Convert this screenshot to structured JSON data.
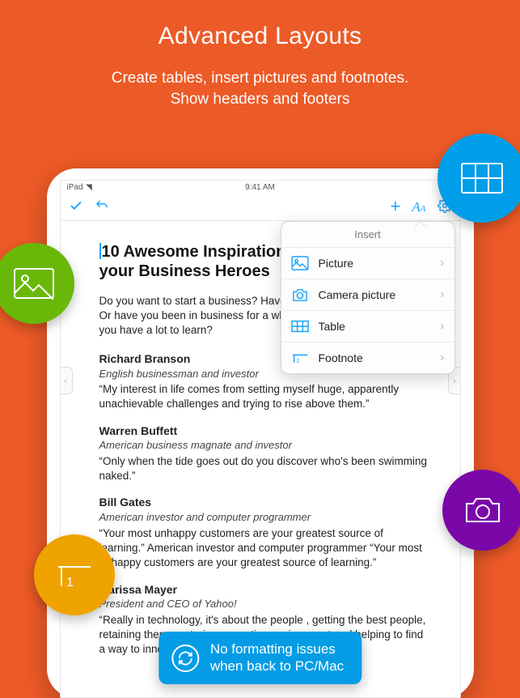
{
  "promo": {
    "title": "Advanced Layouts",
    "subtitle_line1": "Create tables, insert pictures and footnotes.",
    "subtitle_line2": "Show headers and footers"
  },
  "status_bar": {
    "device": "iPad",
    "wifi_icon": "wifi-icon",
    "time": "9:41 AM"
  },
  "toolbar": {
    "confirm_icon": "checkmark-icon",
    "undo_icon": "undo-icon",
    "add_icon": "plus-icon",
    "format_icon": "text-format-icon",
    "settings_icon": "gear-icon"
  },
  "popover": {
    "title": "Insert",
    "items": [
      {
        "icon": "picture-icon",
        "label": "Picture"
      },
      {
        "icon": "camera-icon",
        "label": "Camera picture"
      },
      {
        "icon": "table-icon",
        "label": "Table"
      },
      {
        "icon": "footnote-icon",
        "label": "Footnote"
      }
    ]
  },
  "document": {
    "heading": "10 Awesome Inspirational Quotes from your Business Heroes",
    "lead": "Do you want to start a business? Have you just launched a startup? Or have you been in business for a while perhaps, but you still feel you have a lot to learn?",
    "people": [
      {
        "name": "Richard Branson",
        "role": "English businessman and investor",
        "quote": "“My interest in life comes from setting myself huge, apparently unachievable challenges and trying to rise above them.”"
      },
      {
        "name": "Warren Buffett",
        "role": "American business magnate and investor",
        "quote": "“Only when the tide goes out do you discover who's been swimming naked.”"
      },
      {
        "name": "Bill Gates",
        "role": "American investor and computer programmer",
        "quote": "“Your most unhappy customers are your greatest source of learning.” American investor and computer programmer “Your most unhappy customers are your greatest source of learning.”"
      },
      {
        "name": "Marissa Mayer",
        "role": "President and CEO of Yahoo!",
        "quote": "“Really in technology, it's about the people , getting the best people, retaining them, nurturing a creative environment and helping to find a way to innovate.”"
      }
    ]
  },
  "feature_circles": {
    "table": "table-icon",
    "image": "picture-icon",
    "footnote": "footnote-icon",
    "camera": "camera-icon"
  },
  "pill": {
    "icon": "refresh-icon",
    "line1": "No formatting issues",
    "line2": "when back to PC/Mac"
  },
  "colors": {
    "background": "#ec5a27",
    "accent_blue": "#009ee8",
    "accent_green": "#69b809",
    "accent_orange": "#eea300",
    "accent_purple": "#7a08a9",
    "toolbar": "#1aa3ff"
  }
}
